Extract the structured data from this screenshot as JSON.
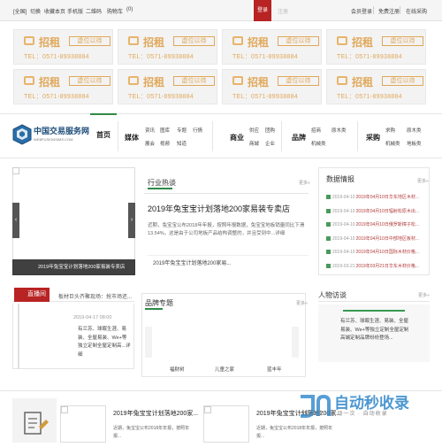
{
  "topbar": {
    "left_links": [
      "[全国]",
      "切换",
      "收藏本页",
      "手机版",
      "二维码",
      "购物车",
      "(0)"
    ],
    "login": "登录",
    "register": "注册",
    "right_links": [
      "会员登录",
      "免费注册",
      "在线采购"
    ]
  },
  "ads": {
    "title": "招租",
    "badge": "虚位以待",
    "tel": "TEL：0571-89938884"
  },
  "logo": {
    "name_cn": "中国交易服务网",
    "name_en": "WEBFUSIONSIMS.COM"
  },
  "nav": {
    "home": "首页",
    "groups": [
      {
        "label": "媒体",
        "items": [
          [
            "资讯",
            "图库",
            "专题",
            "行情"
          ],
          [
            "展会",
            "视频",
            "知道"
          ]
        ]
      },
      {
        "label": "商业",
        "items": [
          [
            "供应",
            "团购"
          ],
          [
            "商城",
            "企业"
          ]
        ]
      },
      {
        "label": "品牌",
        "items": [
          [
            "招商"
          ],
          [
            "机械类"
          ]
        ]
      },
      {
        "label": "采购",
        "items": [
          [
            "求购",
            "原木类"
          ],
          [
            "机械类",
            "地板类"
          ]
        ]
      }
    ],
    "group_extras": [
      {
        "label_after": "原木类",
        "items": [
          "板材类"
        ]
      }
    ]
  },
  "slider": {
    "caption": "2019年兔宝宝计划落地200家易装专卖店",
    "prev": "‹",
    "next": "›"
  },
  "hot": {
    "title": "行业热谈",
    "more": "更多»",
    "headline": "2019年兔宝宝计划落地200家易装专卖店",
    "body": "近期，兔宝宝公布2018年年报，按照年报数据，兔宝宝地板销量同比下滑13.54%，这是由于公司地板产品结构调整的，并且受到中...详细",
    "sub": "2019年兔宝宝计划落地200家易..."
  },
  "data_panel": {
    "title": "数据情报",
    "more": "更多»",
    "rows": [
      {
        "date": "2019-04-10",
        "text": "2019年04月10日华东地区木材..."
      },
      {
        "date": "2019-04-10",
        "text": "2019年04月10日辐射松原木出..."
      },
      {
        "date": "2019-04-10",
        "text": "2019年04月10日俄罗斯樟子松..."
      },
      {
        "date": "2019-04-10",
        "text": "2019年04月10日中部地区板材..."
      },
      {
        "date": "2019-04-10",
        "text": "2019年04月10日国际木材价格..."
      },
      {
        "date": "2019-03-21",
        "text": "2019年03月21日华东木材价格..."
      }
    ]
  },
  "live": {
    "badge": "直播间",
    "marquee": "板材巨头齐聚现场：抢市场还...",
    "date": "2019-04-17 08:00",
    "text": "有兰苏、球眠生涯、易装、全屋易装、We+等独立定制全屋定制高...详细"
  },
  "brand": {
    "title": "品牌专题",
    "more": "更多»",
    "captions": [
      "福财树",
      "儿童之家",
      "蓝丰年"
    ]
  },
  "people": {
    "title": "人物访谈",
    "more": "更多»",
    "text": "有兰苏、球眠生涯、易装、全屋易装、We+等独立定制全屋定制高端定制品牌纷纷登场..."
  },
  "bottom": {
    "items": [
      {
        "title": "2019年兔宝宝计划落地200家...",
        "body": "近期，兔宝宝公布2018年年报，按照年报..."
      },
      {
        "title": "2019年兔宝宝计划落地200家...",
        "body": "近期，兔宝宝公布2018年年报，按照年报..."
      }
    ]
  },
  "watermark": {
    "title": "自动秒收录",
    "sub": "一键上传 · 未动一次 · 自动收录"
  },
  "colors": {
    "accent_green": "#2f8a46",
    "accent_red": "#b82323",
    "ad_gold": "#e0a85a"
  }
}
